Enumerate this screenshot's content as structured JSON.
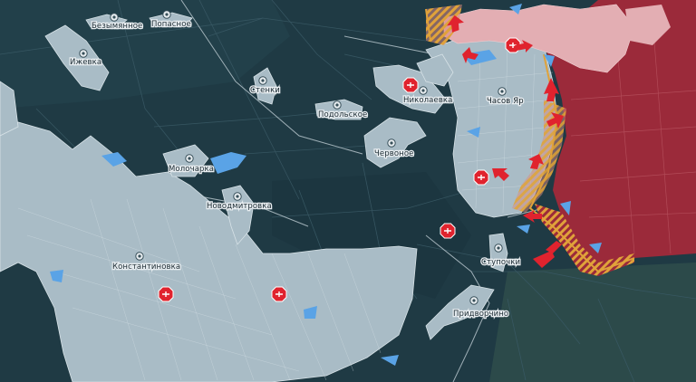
{
  "colors": {
    "background": "#1f3a44",
    "settlement": "#a9bcc6",
    "occupied": "#9b2a3a",
    "contested_stripes": "#e0a23a",
    "water": "#5aa3e6",
    "arrow": "#e0232e"
  },
  "settlements": [
    {
      "id": "bezimenne",
      "name": "Безымянное"
    },
    {
      "id": "popasnoe",
      "name": "Попасное"
    },
    {
      "id": "izhevka",
      "name": "Ижевка"
    },
    {
      "id": "stenki",
      "name": "Стенки"
    },
    {
      "id": "nikolaevka",
      "name": "Николаевка"
    },
    {
      "id": "chasov-yar",
      "name": "Часов Яр"
    },
    {
      "id": "podolskoe",
      "name": "Подольское"
    },
    {
      "id": "chervonoe",
      "name": "Червоное"
    },
    {
      "id": "molocharka",
      "name": "Молочарка"
    },
    {
      "id": "novodmitrovka",
      "name": "Новодмитровка"
    },
    {
      "id": "konstantinovka",
      "name": "Константиновка"
    },
    {
      "id": "stupochki",
      "name": "Ступочки"
    },
    {
      "id": "pridvorchino",
      "name": "Придворчино"
    }
  ],
  "icons": {
    "settlement_marker": "pin-icon",
    "military_marker": "octagon-badge-icon",
    "attack_arrow": "arrow-icon"
  }
}
